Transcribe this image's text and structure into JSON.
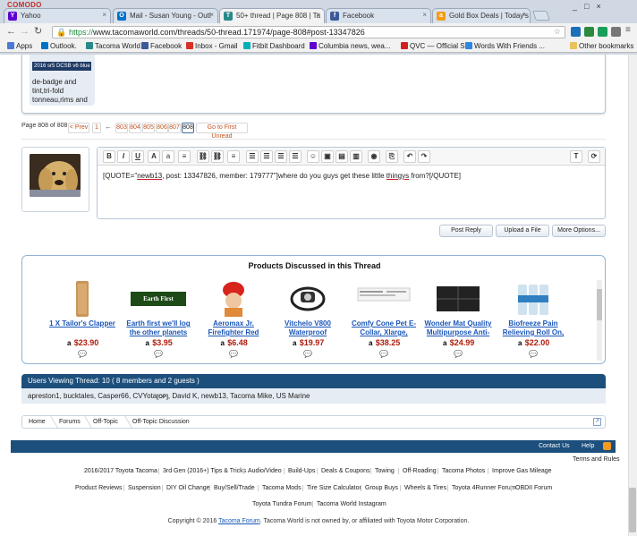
{
  "browser": {
    "brand": "COMODO",
    "tabs": [
      {
        "label": "Yahoo",
        "favicon": "Y",
        "color": "#5f01d1"
      },
      {
        "label": "Mail - Susan Young - Outl",
        "favicon": "O",
        "color": "#0072c6"
      },
      {
        "label": "50+ thread | Page 808 | Ta",
        "favicon": "T",
        "color": "#2a8a8a"
      },
      {
        "label": "Facebook",
        "favicon": "f",
        "color": "#3b5998"
      },
      {
        "label": "Gold Box Deals | Today's",
        "favicon": "a",
        "color": "#f39c12"
      }
    ],
    "url_scheme": "https://",
    "url_rest": "www.tacomaworld.com/threads/50-thread.171974/page-808#post-13347826",
    "bookmarks": [
      {
        "label": "Apps",
        "color": "#4a7bd6"
      },
      {
        "label": "Outlook.",
        "color": "#0072c6"
      },
      {
        "label": "Tacoma World",
        "color": "#2a8a8a"
      },
      {
        "label": "Facebook",
        "color": "#3b5998"
      },
      {
        "label": "Inbox - Gmail",
        "color": "#d93025"
      },
      {
        "label": "Fitbit Dashboard",
        "color": "#00b0b9"
      },
      {
        "label": "Columbia news, wea...",
        "color": "#5f01d1"
      },
      {
        "label": "QVC — Official Site",
        "color": "#d41f1f"
      },
      {
        "label": "Words With Friends ...",
        "color": "#2e86de"
      },
      {
        "label": "Other bookmarks",
        "color": "#e8c25a"
      }
    ]
  },
  "signature": {
    "image_label": "2016 sr5 DCSB v6 blue",
    "text": "de-badge and tint,tri-fold tonneau,rims and"
  },
  "pagenav": {
    "label": "Page 808 of 808",
    "prev": "< Prev",
    "first": "1",
    "arrow": "←",
    "pages": [
      "803",
      "804",
      "805",
      "806",
      "807",
      "808"
    ],
    "unread": "Go to First Unread"
  },
  "editor": {
    "toolbar": [
      "B",
      "I",
      "U",
      "A",
      "a",
      "≡",
      "⛓",
      "⛓",
      "≡",
      "☰",
      "☰",
      "☰",
      "☰",
      "☺",
      "▣",
      "▤",
      "▥",
      "◉",
      "⎘",
      "↶",
      "↷",
      "T",
      "⟳"
    ],
    "content_pre": "[QUOTE=\"",
    "content_user": "newb13",
    "content_mid": ", post: 13347826, member: 179777\"]where do you guys get these little ",
    "content_word": "thingys",
    "content_post": " from?[/QUOTE]"
  },
  "actions": {
    "post_reply": "Post Reply",
    "upload": "Upload a File",
    "more": "More Options..."
  },
  "products": {
    "title": "Products Discussed in this Thread",
    "items": [
      {
        "name": "1 X Tailor's Clapper",
        "price": "$23.90"
      },
      {
        "name": "Earth first we'll log the other planets",
        "price": "$3.95",
        "banner": "Earth First"
      },
      {
        "name": "Aeromax Jr. Firefighter Red",
        "price": "$6.48"
      },
      {
        "name": "Vitchelo V800 Waterproof",
        "price": "$19.97"
      },
      {
        "name": "Comfy Cone Pet E-Collar, Xlarge,",
        "price": "$38.25"
      },
      {
        "name": "Wonder Mat Quality Multipurpose Anti-",
        "price": "$24.99"
      },
      {
        "name": "Biofreeze Pain Relieving Roll On,",
        "price": "$22.00"
      }
    ]
  },
  "viewers": {
    "heading": "Users Viewing Thread: 10 ( 8 members and 2 guests )",
    "list_pre": "apreston1, bucktales, Casper66, CVYota",
    "op": "[OP]",
    "list_post": ", David K, newb13, Tacoma Mike, US Marine"
  },
  "breadcrumb": [
    "Home",
    "Forums",
    "Off-Topic",
    "Off-Topic Discussion"
  ],
  "footer": {
    "contact": "Contact Us",
    "help": "Help",
    "terms": "Terms and Rules",
    "row1": [
      "2016/2017 Toyota Tacoma",
      "3rd Gen (2016+) Tips & Tricks",
      "Audio/Video",
      "Build-Ups",
      "Deals & Coupons",
      "Towing",
      "Off-Roading",
      "Tacoma Photos",
      "Improve Gas Mileage"
    ],
    "row2": [
      "Product Reviews",
      "Suspension",
      "DIY Oil Change",
      "Buy/Sell/Trade",
      "Tacoma Mods",
      "Tire Size Calculator",
      "Group Buys",
      "Wheels & Tires",
      "Toyota 4Runner Forum",
      "OBDII Forum"
    ],
    "row3": [
      "Toyota Tundra Forum",
      "Tacoma World Instagram"
    ],
    "copyright_pre": "Copyright © 2016 ",
    "copyright_link": "Tacoma Forum",
    "copyright_post": ". Tacoma World is not owned by, or affiliated with Toyota Motor Corporation."
  }
}
